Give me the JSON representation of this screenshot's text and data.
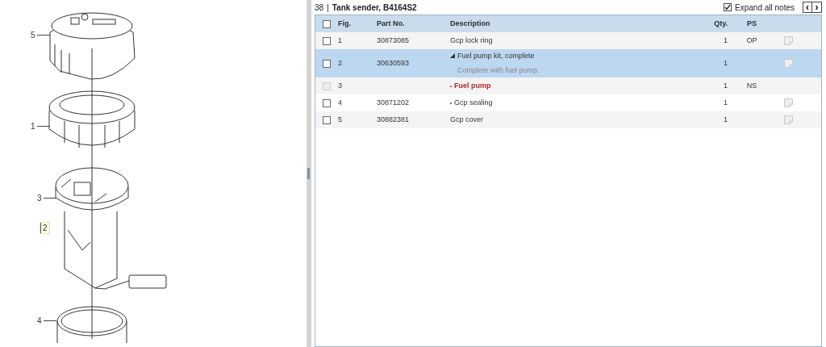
{
  "diagram": {
    "callouts": [
      {
        "label": "5",
        "boxed": false
      },
      {
        "label": "1",
        "boxed": false
      },
      {
        "label": "3",
        "boxed": false
      },
      {
        "label": "2",
        "boxed": true
      },
      {
        "label": "4",
        "boxed": false
      }
    ]
  },
  "header": {
    "number": "38",
    "separator": "|",
    "title": "Tank sender, B4164S2",
    "expand_notes": {
      "label": "Expand all notes",
      "checked": true
    },
    "prev": "‹",
    "next": "›"
  },
  "table": {
    "select_all": {
      "checked": false
    },
    "columns": [
      "Fig.",
      "Part No.",
      "Description",
      "Qty.",
      "PS"
    ],
    "rows": [
      {
        "fig": "1",
        "part_no": "30873085",
        "kind": "part",
        "description": "Gcp lock ring",
        "qty": "1",
        "ps": "OP",
        "note_icon": true,
        "selected": false,
        "checked": false,
        "disabled": false,
        "emphasized": false
      },
      {
        "fig": "2",
        "part_no": "30630593",
        "kind": "assembly",
        "expanded": true,
        "description": "Fuel pump kit, complete",
        "note": "Complete with fuel pump.",
        "qty": "1",
        "note_icon": true,
        "selected": true,
        "checked": false,
        "disabled": false,
        "emphasized": false
      },
      {
        "fig": "3",
        "kind": "component",
        "description": "Fuel pump",
        "qty": "1",
        "ps": "NS",
        "note_icon": false,
        "selected": false,
        "checked": false,
        "disabled": true,
        "emphasized": true
      },
      {
        "fig": "4",
        "part_no": "30871202",
        "kind": "component",
        "description": "Gcp sealing",
        "qty": "1",
        "note_icon": true,
        "selected": false,
        "checked": false,
        "disabled": false,
        "emphasized": false
      },
      {
        "fig": "5",
        "part_no": "30882381",
        "kind": "part",
        "description": "Gcp cover",
        "qty": "1",
        "note_icon": true,
        "selected": false,
        "checked": false,
        "disabled": false,
        "emphasized": false
      }
    ]
  }
}
